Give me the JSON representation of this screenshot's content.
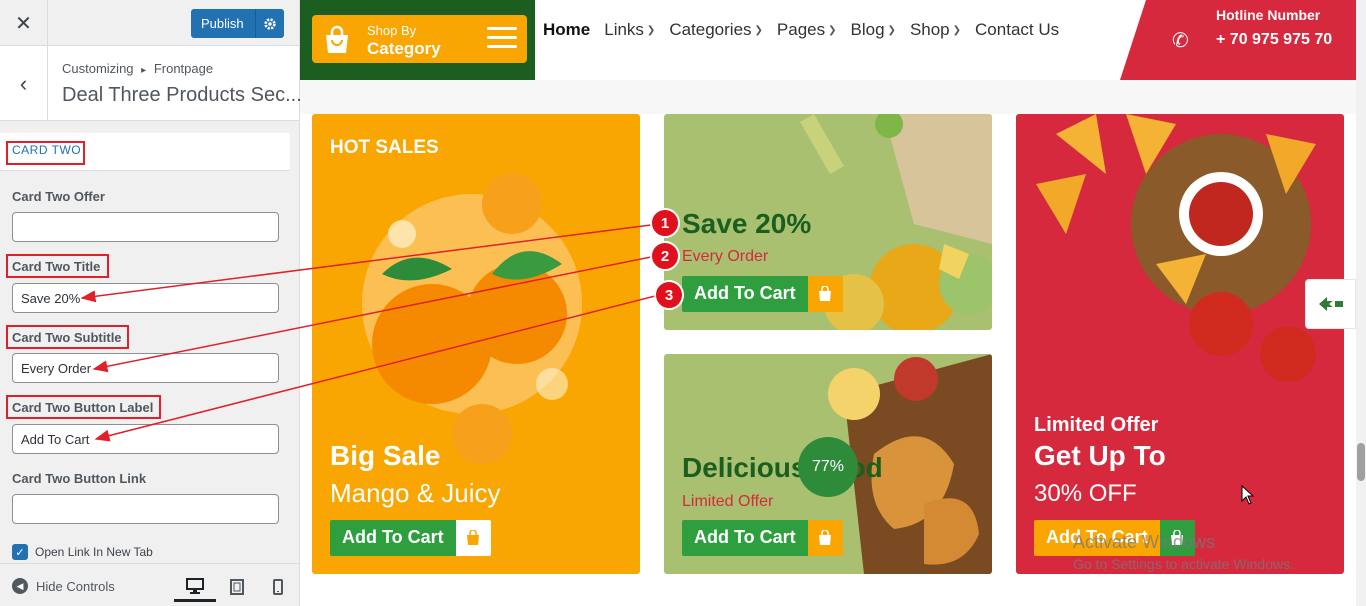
{
  "customizer": {
    "close_icon": "close-icon",
    "publish_label": "Publish",
    "breadcrumb_root": "Customizing",
    "breadcrumb_sep": "▸",
    "breadcrumb_parent": "Frontpage",
    "section_title": "Deal Three Products Sec...",
    "card_heading": "CARD TWO",
    "fields": [
      {
        "label": "Card Two Offer",
        "value": ""
      },
      {
        "label": "Card Two Title",
        "value": "Save 20%"
      },
      {
        "label": "Card Two Subtitle",
        "value": "Every Order"
      },
      {
        "label": "Card Two Button Label",
        "value": "Add To Cart"
      },
      {
        "label": "Card Two Button Link",
        "value": ""
      }
    ],
    "checkbox_label": "Open Link In New Tab",
    "checkbox_checked": true,
    "hide_controls_label": "Hide Controls"
  },
  "header": {
    "shop_by": "Shop By",
    "category": "Category",
    "nav": [
      "Home",
      "Links",
      "Categories",
      "Pages",
      "Blog",
      "Shop",
      "Contact Us"
    ],
    "nav_has_dropdown": [
      false,
      true,
      true,
      true,
      true,
      true,
      false
    ],
    "hotline_title": "Hotline Number",
    "hotline_number": "+ 70 975 975 70"
  },
  "cards": {
    "card1": {
      "tag": "HOT SALES",
      "title": "Big Sale",
      "subtitle": "Mango & Juicy",
      "button": "Add To Cart"
    },
    "card2": {
      "title": "Save 20%",
      "subtitle": "Every Order",
      "button": "Add To Cart"
    },
    "card3": {
      "title": "Delicious Food",
      "subtitle": "Limited Offer",
      "button": "Add To Cart",
      "badge": "77%"
    },
    "card4": {
      "subtitle": "Limited Offer",
      "title": "Get Up To",
      "offer": "30% OFF",
      "button": "Add To Cart"
    }
  },
  "markers": [
    "1",
    "2",
    "3"
  ],
  "watermark": {
    "line1": "Activate Windows",
    "line2": "Go to Settings to activate Windows."
  },
  "colors": {
    "accent": "#2271b1",
    "brand_green": "#1b5e20",
    "brand_orange": "#f9a602",
    "brand_red": "#d6293e",
    "button_green": "#2e9e3e",
    "annotation_red": "#e0202a"
  }
}
